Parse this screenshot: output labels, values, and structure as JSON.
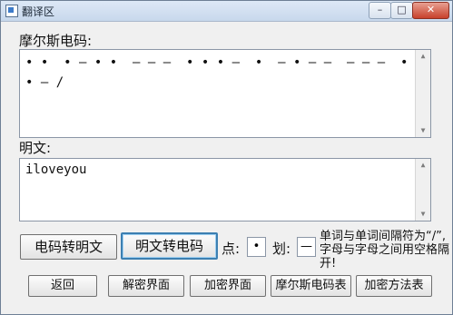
{
  "window": {
    "title": "翻译区"
  },
  "controls": {
    "minimize": "–",
    "maximize": "□",
    "close": "✕"
  },
  "morse_section": {
    "label": "摩尔斯电码:",
    "value": "• •  • — • •  — — —  • • • —  •  — • — —  — — —  •  • — /"
  },
  "plain_section": {
    "label": "明文:",
    "value": "iloveyou"
  },
  "convert": {
    "to_plain": "电码转明文",
    "to_morse": "明文转电码"
  },
  "symbols": {
    "dot_label": "点:",
    "dot_value": "•",
    "dash_label": "划:",
    "dash_value": "—"
  },
  "note": "单词与单词间隔符为“/”,字母与字母之间用空格隔开!",
  "bottom_buttons": [
    "返回",
    "解密界面",
    "加密界面",
    "摩尔斯电码表",
    "加密方法表"
  ]
}
